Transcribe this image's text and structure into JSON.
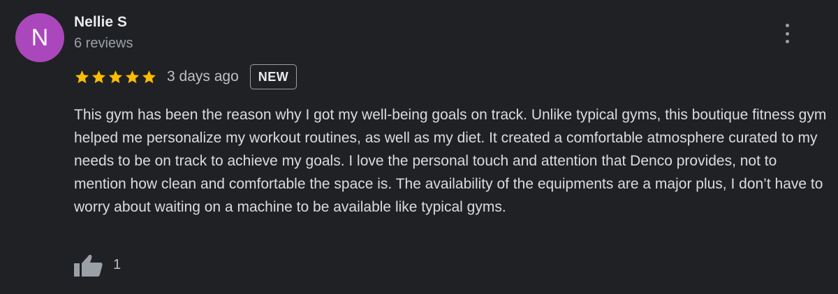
{
  "reviewer": {
    "initial": "N",
    "avatar_color": "#ab47bc",
    "name": "Nellie S",
    "review_count": "6 reviews"
  },
  "menu": {
    "icon": "more-vert-icon"
  },
  "rating": {
    "stars": 5,
    "max_stars": 5,
    "star_color": "#fbbc04",
    "date": "3 days ago",
    "badge": "NEW"
  },
  "review": {
    "text": "This gym has been the reason why I got my well-being goals on track. Unlike typical gyms, this boutique fitness gym helped me personalize my workout routines, as well as my diet. It created a comfortable atmosphere curated to my needs to be on track to achieve my goals. I love the personal touch and attention that Denco provides, not to mention how clean and comfortable the space is. The availability of the equipments are a major plus, I don’t have to worry about waiting on a machine to be available like typical gyms."
  },
  "actions": {
    "like_icon": "thumbs-up-icon",
    "like_count": "1"
  }
}
